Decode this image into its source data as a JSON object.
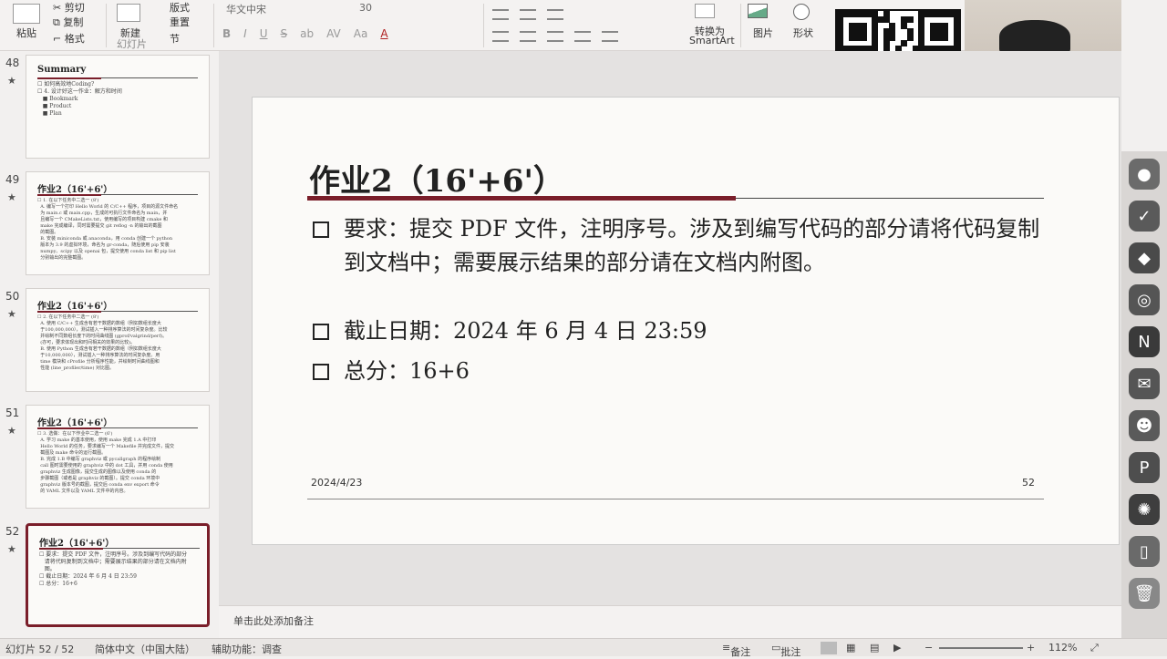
{
  "ribbon": {
    "paste": "粘贴",
    "cut": "剪切",
    "copy": "复制",
    "format": "格式",
    "new_slide": "新建",
    "new_slide_sub": "幻灯片",
    "layout": "版式",
    "reset": "重置",
    "section": "节",
    "font_name": "华文中宋",
    "font_size": "30",
    "convert_smartart": "转换为",
    "convert_smartart_sub": "SmartArt",
    "picture": "图片",
    "shape": "形状",
    "format_buttons": [
      "B",
      "I",
      "U",
      "S",
      "ab",
      "AV",
      "Aa",
      "A"
    ]
  },
  "thumbnails": [
    {
      "num": "48",
      "title": "Summary",
      "lines": "☐ 如何高效地Coding?\n☐ 4. 设计好这一作业：解方和时间\n   ■ Bookmark\n   ■ Product\n   ■ Plan"
    },
    {
      "num": "49",
      "title": "作业2（16'+6'）",
      "lines": "☐ 1. 在以下任务中二选一 (8')\n  A. 编写一个打印 Hello World 的 C/C++ 程序，项目的源文件命名\n  为 main.c 或 main.cpp，生成的可执行文件命名为 main，并\n  且编写一个 CMakeLists.txt，使用编写的项目构建 cmake 和\n  make 完成编译，同时需要提交 git reflog -n 的输出的截图\n  的截图。\n  B. 安装 miniconda 或 anaconda，用 conda 创建一个 python\n  版本为 3.9 的虚拟环境，命名为 gr-conda，随后使用 pip 安装\n  numpy、scipy 以及 openai 包，提交使用 conda list 和 pip list\n  分别输出的完整截图。"
    },
    {
      "num": "50",
      "title": "作业2（16'+6'）",
      "lines": "☐ 2. 在以下任务中二选一 (8')\n  A. 使用 C/C++ 生成含有若干数据的数组（例如数组长度大\n  于100,000,000），测试插入一种排序算法的时间复杂度。比较\n  并绘制不同数组长度下的时间曲线图 (gprof/valgrind/perf)。\n  (亦可，要求体现出和时间相关的效果的比较)。\n  B. 使用 Python 生成含有若干数据的数组（例如数组长度大\n  于10,000,000），测试插入一种排序算法的时间复杂度。用\n  time 模块和 cProfile 分析程序性能，并绘制时间曲线图和\n  性能 (line_profiler/time) 对比图。"
    },
    {
      "num": "51",
      "title": "作业2（16'+6'）",
      "lines": "☐ 3. 选做：在以下作业中二选一 (6')\n  A. 学习 make 的基本使用，使用 make 完成 1.A 中打印\n  Hello World 的任务，要求编写一个 Makefile 并完成文件，提交\n  截图及 make 命令的运行截图。\n  B. 完成 1.B 中编写 graphviz 或 pycallgraph 的程序绘制\n  call 图时需要使用的 graphviz 中的 dot 工具，并用 conda 使用\n  graphviz 生成图像，提交生成的图像以及使用 conda 的\n  步骤截图（或者是 graphviz 的截图）。提交 conda 环境中\n  graphviz 版本号的截图，提交后 conda env export 命令\n  的 YAML 文件以及 YAML 文件中的内容。"
    },
    {
      "num": "52",
      "title": "作业2（16'+6'）",
      "lines": "☐ 要求：提交 PDF 文件，注明序号。涉及到编写代码的部分\n   请将代码复制到文档中；需要展示结果的部分请在文档内附\n   图。\n☐ 截止日期：2024 年 6 月 4 日 23:59\n☐ 总分：16+6"
    }
  ],
  "slide": {
    "title": "作业2（16'+6'）",
    "bullets": [
      "要求：提交 PDF 文件，注明序号。涉及到编写代码的部分请将代码复制到文档中；需要展示结果的部分请在文档内附图。",
      "截止日期：2024 年 6 月 4 日 23:59",
      "总分：16+6"
    ],
    "date": "2024/4/23",
    "page": "52",
    "accent_color": "#7a1e2a"
  },
  "notes_placeholder": "单击此处添加备注",
  "status": {
    "slide_info": "幻灯片 52 / 52",
    "language": "简体中文（中国大陆）",
    "accessibility": "辅助功能：调查",
    "notes": "备注",
    "comments": "批注",
    "zoom": "112%"
  },
  "dock_icons": [
    "wechat-icon",
    "check-icon",
    "vscode-icon",
    "edge-icon",
    "notion-icon",
    "mail-icon",
    "discord-icon",
    "powerpoint-icon",
    "chatgpt-icon",
    "file-icon",
    "trash-icon"
  ]
}
